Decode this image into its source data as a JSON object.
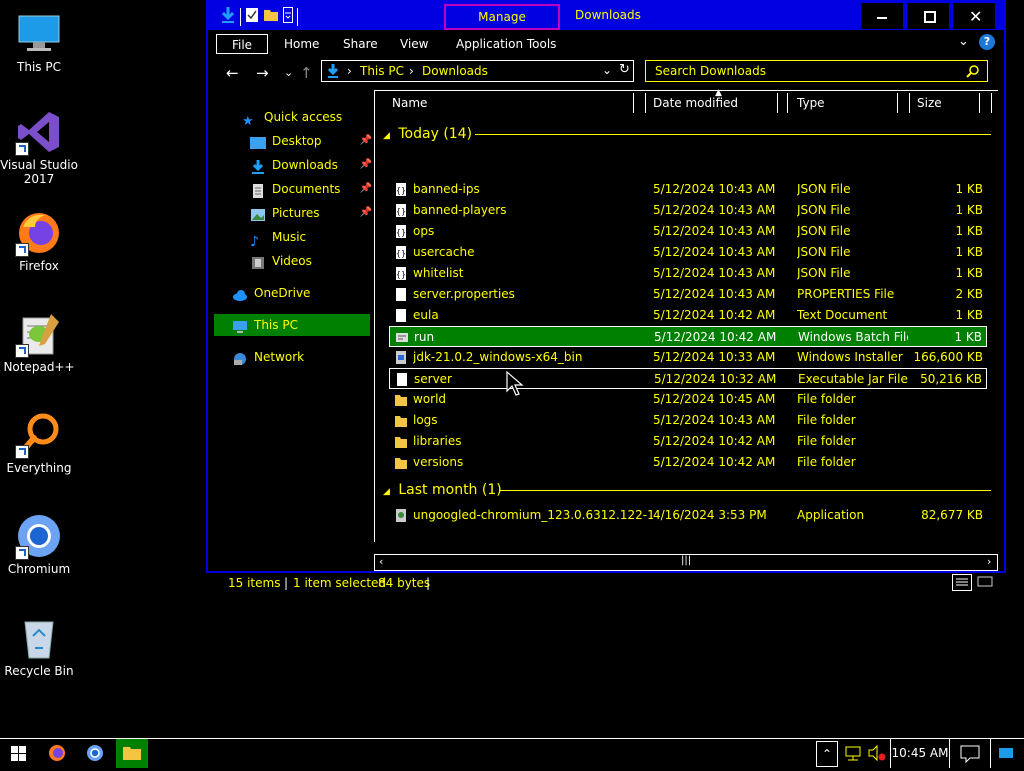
{
  "desktop": {
    "icons": [
      {
        "label": "This PC"
      },
      {
        "label": "Visual Studio 2017"
      },
      {
        "label": "Firefox"
      },
      {
        "label": "Notepad++"
      },
      {
        "label": "Everything"
      },
      {
        "label": "Chromium"
      },
      {
        "label": "Recycle Bin"
      }
    ]
  },
  "window": {
    "title": "Downloads",
    "context_tab": "Manage",
    "ribbon_tabs": [
      "File",
      "Home",
      "Share",
      "View",
      "Application Tools"
    ],
    "address": {
      "segments": [
        "This PC",
        "Downloads"
      ]
    },
    "search": {
      "placeholder": "Search Downloads"
    }
  },
  "navpane": {
    "items": [
      {
        "label": "Quick access"
      },
      {
        "label": "Desktop"
      },
      {
        "label": "Downloads"
      },
      {
        "label": "Documents"
      },
      {
        "label": "Pictures"
      },
      {
        "label": "Music"
      },
      {
        "label": "Videos"
      },
      {
        "label": "OneDrive"
      },
      {
        "label": "This PC"
      },
      {
        "label": "Network"
      }
    ]
  },
  "columns": [
    "Name",
    "Date modified",
    "Type",
    "Size"
  ],
  "groups": [
    {
      "label": "Today (14)"
    },
    {
      "label": "Last month (1)"
    }
  ],
  "files": [
    {
      "name": "banned-ips",
      "date": "5/12/2024 10:43 AM",
      "type": "JSON File",
      "size": "1 KB"
    },
    {
      "name": "banned-players",
      "date": "5/12/2024 10:43 AM",
      "type": "JSON File",
      "size": "1 KB"
    },
    {
      "name": "ops",
      "date": "5/12/2024 10:43 AM",
      "type": "JSON File",
      "size": "1 KB"
    },
    {
      "name": "usercache",
      "date": "5/12/2024 10:43 AM",
      "type": "JSON File",
      "size": "1 KB"
    },
    {
      "name": "whitelist",
      "date": "5/12/2024 10:43 AM",
      "type": "JSON File",
      "size": "1 KB"
    },
    {
      "name": "server.properties",
      "date": "5/12/2024 10:43 AM",
      "type": "PROPERTIES File",
      "size": "2 KB"
    },
    {
      "name": "eula",
      "date": "5/12/2024 10:42 AM",
      "type": "Text Document",
      "size": "1 KB"
    },
    {
      "name": "run",
      "date": "5/12/2024 10:42 AM",
      "type": "Windows Batch File",
      "size": "1 KB"
    },
    {
      "name": "jdk-21.0.2_windows-x64_bin",
      "date": "5/12/2024 10:33 AM",
      "type": "Windows Installer ...",
      "size": "166,600 KB"
    },
    {
      "name": "server",
      "date": "5/12/2024 10:32 AM",
      "type": "Executable Jar File",
      "size": "50,216 KB"
    },
    {
      "name": "world",
      "date": "5/12/2024 10:45 AM",
      "type": "File folder",
      "size": ""
    },
    {
      "name": "logs",
      "date": "5/12/2024 10:43 AM",
      "type": "File folder",
      "size": ""
    },
    {
      "name": "libraries",
      "date": "5/12/2024 10:42 AM",
      "type": "File folder",
      "size": ""
    },
    {
      "name": "versions",
      "date": "5/12/2024 10:42 AM",
      "type": "File folder",
      "size": ""
    },
    {
      "name": "ungoogled-chromium_123.0.6312.122-1....",
      "date": "4/16/2024 3:53 PM",
      "type": "Application",
      "size": "82,677 KB"
    }
  ],
  "status": {
    "count": "15 items",
    "selection": "1 item selected",
    "size": "84 bytes"
  },
  "taskbar": {
    "time": "10:45 AM"
  },
  "colors": {
    "window_border": "#0000e0",
    "text": "#ffff00",
    "selection": "#008000"
  }
}
